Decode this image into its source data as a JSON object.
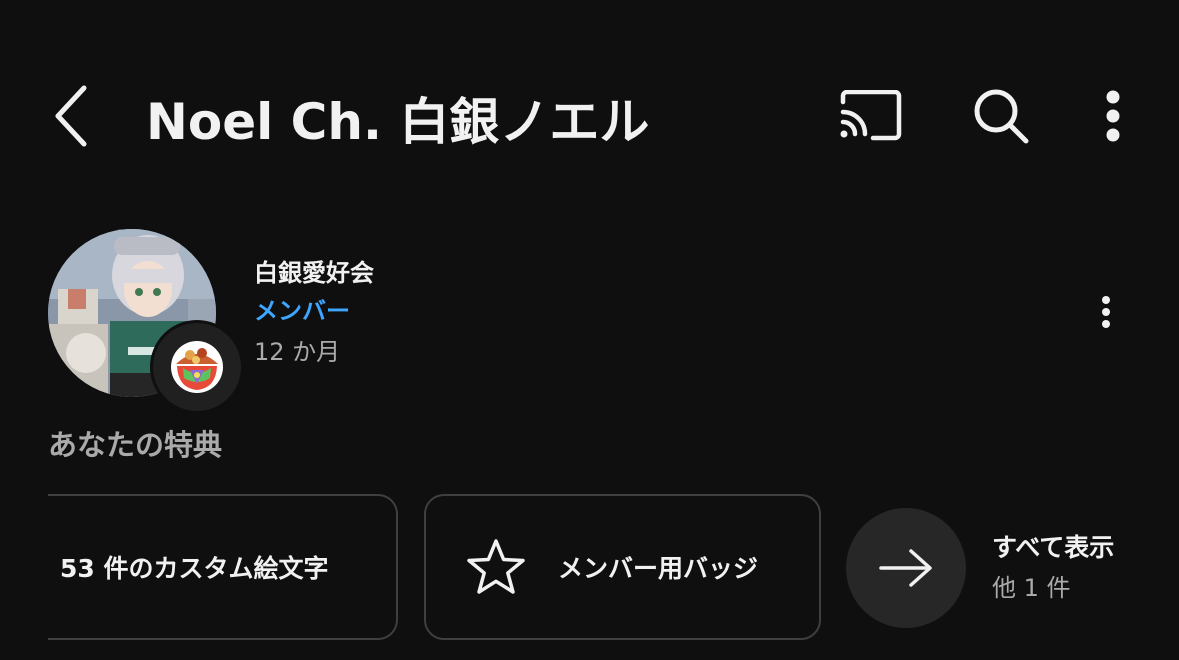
{
  "header": {
    "title": "Noel Ch. 白銀ノエル",
    "back_icon": "chevron-left-icon",
    "actions": [
      "cast-icon",
      "search-icon",
      "more-vertical-icon"
    ]
  },
  "membership": {
    "level_name": "白銀愛好会",
    "status": "メンバー",
    "duration": "12 か月",
    "status_color": "#3ea6ff"
  },
  "perks": {
    "title": "あなたの特典",
    "items": [
      {
        "label": "53 件のカスタム絵文字"
      },
      {
        "label": "メンバー用バッジ",
        "icon": "star-outline-icon"
      }
    ],
    "see_all": {
      "label": "すべて表示",
      "sub": "他 1 件",
      "icon": "arrow-right-icon"
    }
  },
  "colors": {
    "background": "#0f0f0f",
    "text_primary": "#f1f1f1",
    "text_secondary": "#aaaaaa",
    "card_border": "#3f3f3f",
    "accent": "#3ea6ff"
  }
}
